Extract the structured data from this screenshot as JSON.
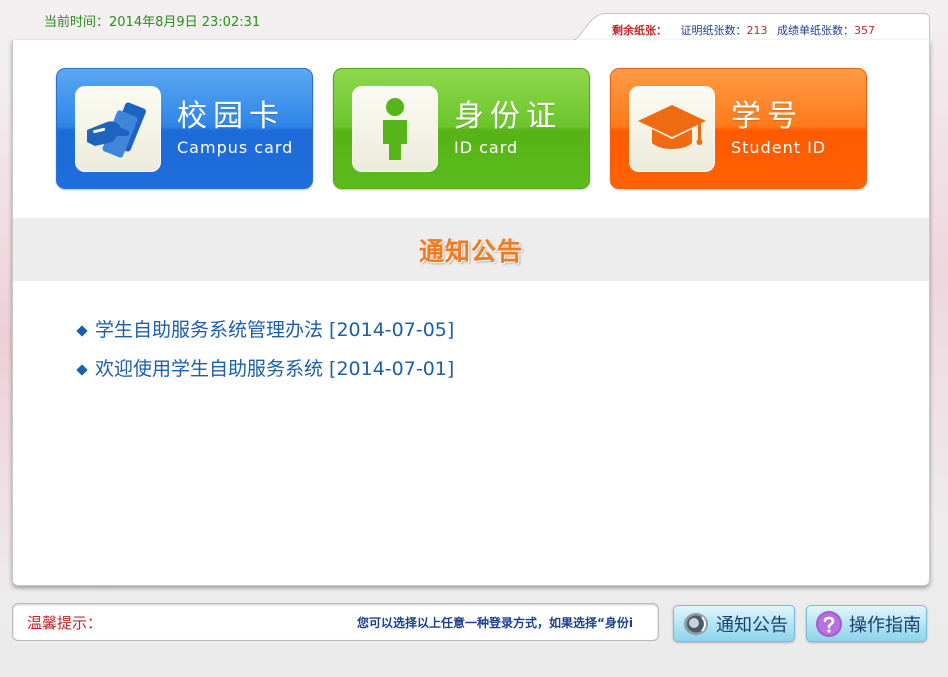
{
  "header": {
    "clock_text": "当前时间：2014年8月9日 23:02:31",
    "paper_status": {
      "label": "剩余纸张：",
      "cert_label": "证明纸张数：",
      "cert_count": "213",
      "transcript_label": "成绩单纸张数：",
      "transcript_count": "357"
    }
  },
  "login_tiles": [
    {
      "title": "校园卡",
      "subtitle": "Campus card",
      "icon": "card-swipe-icon",
      "color": "#2f85e8"
    },
    {
      "title": "身份证",
      "subtitle": "ID card",
      "icon": "person-icon",
      "color": "#6cc52c"
    },
    {
      "title": "学号",
      "subtitle": "Student ID",
      "icon": "graduation-cap-icon",
      "color": "#ff6a0a"
    }
  ],
  "notice_section": {
    "heading": "通知公告",
    "items": [
      {
        "text": "学生自助服务系统管理办法 [2014-07-05]"
      },
      {
        "text": "欢迎使用学生自助服务系统 [2014-07-01]"
      }
    ]
  },
  "footer": {
    "tip_label": "温馨提示：",
    "tip_text": "您可以选择以上任意一种登录方式，如果选择“身份i",
    "buttons": [
      {
        "label": "通知公告",
        "icon": "speaker-icon"
      },
      {
        "label": "操作指南",
        "icon": "question-icon"
      }
    ]
  },
  "colors": {
    "accent_blue": "#1b5fab",
    "accent_red": "#c0282c",
    "clock_green": "#2e8b1e",
    "heading_orange": "#f07a20"
  }
}
